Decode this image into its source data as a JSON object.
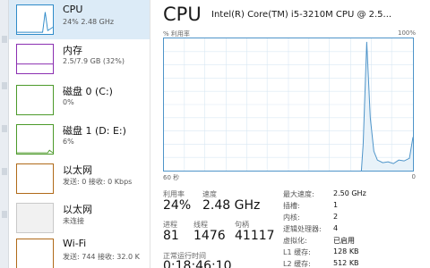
{
  "sidebar": {
    "items": [
      {
        "title": "CPU",
        "subtitle": "24% 2.48 GHz",
        "selected": true,
        "icon": "cpu-graph-thumbnail",
        "color": "#2f8bc9"
      },
      {
        "title": "内存",
        "subtitle": "2.5/7.9 GB (32%)",
        "icon": "memory-graph-thumbnail",
        "color": "#8b2fb1"
      },
      {
        "title": "磁盘 0 (C:)",
        "subtitle": "0%",
        "icon": "disk-graph-thumbnail",
        "color": "#4c9a2a"
      },
      {
        "title": "磁盘 1 (D: E:)",
        "subtitle": "6%",
        "icon": "disk-graph-thumbnail",
        "color": "#4c9a2a"
      },
      {
        "title": "以太网",
        "subtitle": "发送: 0 接收: 0 Kbps",
        "icon": "ethernet-graph-thumbnail",
        "color": "#b06a19"
      },
      {
        "title": "以太网",
        "subtitle": "未连接",
        "icon": "ethernet-graph-thumbnail",
        "color": "#c9c9c9"
      },
      {
        "title": "Wi-Fi",
        "subtitle": "发送: 744 接收: 32.0 K",
        "icon": "wifi-graph-thumbnail",
        "color": "#b06a19"
      }
    ]
  },
  "main": {
    "title": "CPU",
    "model": "Intel(R) Core(TM) i5-3210M CPU @ 2.5...",
    "graph": {
      "top_left": "% 利用率",
      "top_right": "100%",
      "bottom_left": "60 秒",
      "bottom_right": "0",
      "line_color": "#4e94c9",
      "fill_color": "#e8f2f9"
    },
    "stats": {
      "utilization_label": "利用率",
      "utilization_value": "24%",
      "speed_label": "速度",
      "speed_value": "2.48 GHz",
      "processes_label": "进程",
      "processes_value": "81",
      "threads_label": "线程",
      "threads_value": "1476",
      "handles_label": "句柄",
      "handles_value": "41117",
      "uptime_label": "正常运行时间",
      "uptime_value": "0:18:46:10"
    },
    "specs": [
      {
        "label": "最大速度:",
        "value": "2.50 GHz"
      },
      {
        "label": "插槽:",
        "value": "1"
      },
      {
        "label": "内核:",
        "value": "2"
      },
      {
        "label": "逻辑处理器:",
        "value": "4"
      },
      {
        "label": "虚拟化:",
        "value": "已启用"
      },
      {
        "label": "L1 缓存:",
        "value": "128 KB"
      },
      {
        "label": "L2 缓存:",
        "value": "512 KB"
      }
    ]
  }
}
